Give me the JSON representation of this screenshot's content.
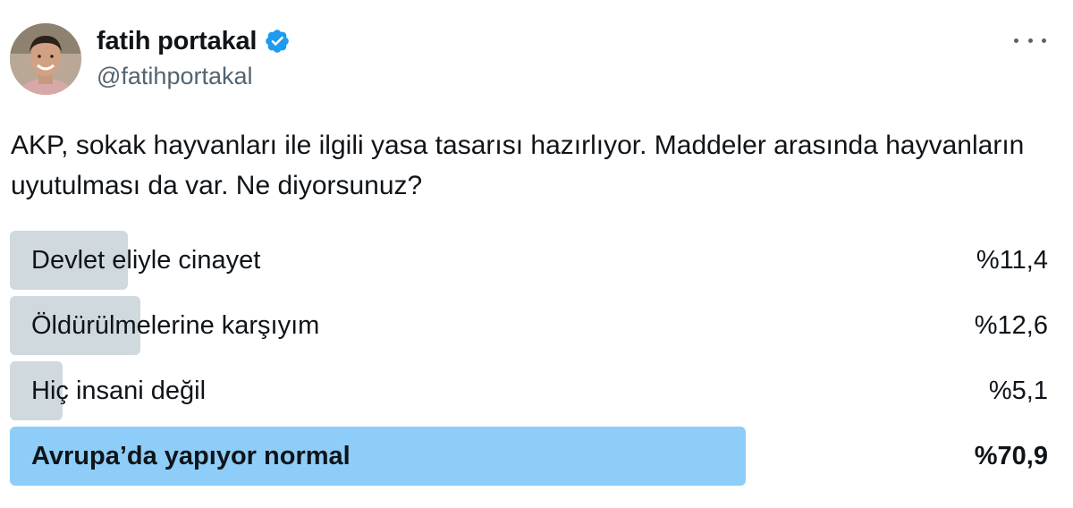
{
  "author": {
    "display_name": "fatih portakal",
    "handle": "@fatihportakal",
    "verified": true,
    "verified_color": "#1d9bf0"
  },
  "tweet": {
    "text": "AKP, sokak hayvanları ile ilgili yasa tasarısı hazırlıyor. Maddeler arasında hayvanların uyutulması da var. Ne diyorsunuz?"
  },
  "poll": {
    "bar_color": "#cfd9de",
    "winner_color": "#8ecdf7",
    "options": [
      {
        "label": "Devlet eliyle cinayet",
        "percent_text": "%11,4",
        "value": 11.4,
        "winner": false
      },
      {
        "label": "Öldürülmelerine karşıyım",
        "percent_text": "%12,6",
        "value": 12.6,
        "winner": false
      },
      {
        "label": "Hiç insani değil",
        "percent_text": "%5,1",
        "value": 5.1,
        "winner": false
      },
      {
        "label": "Avrupa’da yapıyor normal",
        "percent_text": "%70,9",
        "value": 70.9,
        "winner": true
      }
    ]
  },
  "icons": {
    "more": "more-horizontal-icon",
    "verified": "verified-badge-icon",
    "avatar": "profile-avatar"
  }
}
